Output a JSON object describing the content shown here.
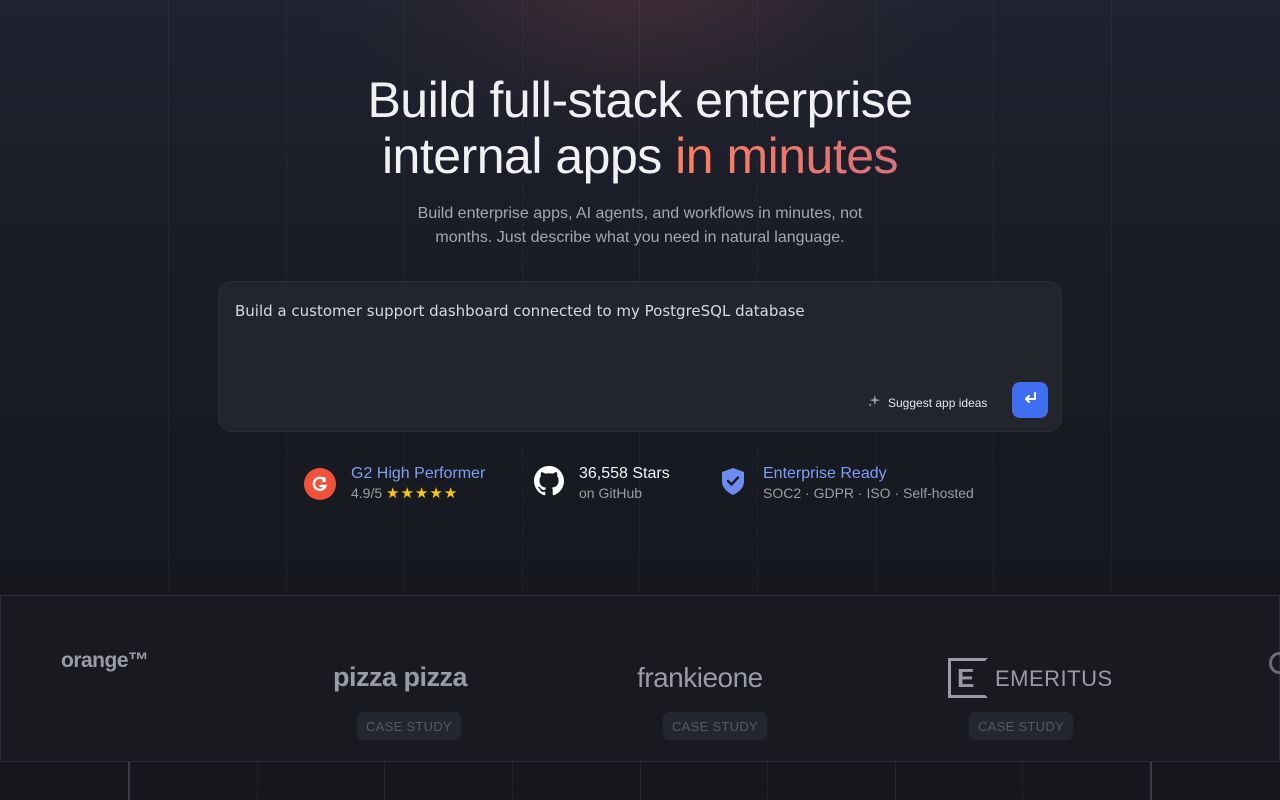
{
  "hero": {
    "title_line1": "Build full-stack enterprise",
    "title_line2_prefix": "internal apps ",
    "title_line2_accent": "in minutes",
    "subtitle": "Build enterprise apps, AI agents, and workflows in minutes, not months. Just describe what you need in natural language."
  },
  "prompt": {
    "value": "Build a customer support dashboard connected to my PostgreSQL database",
    "suggest_label": "Suggest app ideas"
  },
  "badges": {
    "g2": {
      "title": "G2 High Performer",
      "rating": "4.9/5",
      "stars": "★★★★★"
    },
    "github": {
      "title": "36,558 Stars",
      "sub": "on GitHub"
    },
    "enterprise": {
      "title": "Enterprise Ready",
      "sub": "SOC2 · GDPR · ISO · Self-hosted"
    }
  },
  "logos": {
    "items": [
      {
        "name": "orange™"
      },
      {
        "name": "pizza pizza",
        "case": "CASE STUDY"
      },
      {
        "name": "frankieone",
        "case": "CASE STUDY"
      },
      {
        "name": "EMERITUS",
        "case": "CASE STUDY"
      }
    ]
  },
  "colors": {
    "accent_gradient_start": "#ff7f5e",
    "accent_gradient_end": "#d9727a",
    "primary_button": "#3f6ff0",
    "link_blue": "#7f9ef6",
    "g2_red": "#f0533a"
  }
}
